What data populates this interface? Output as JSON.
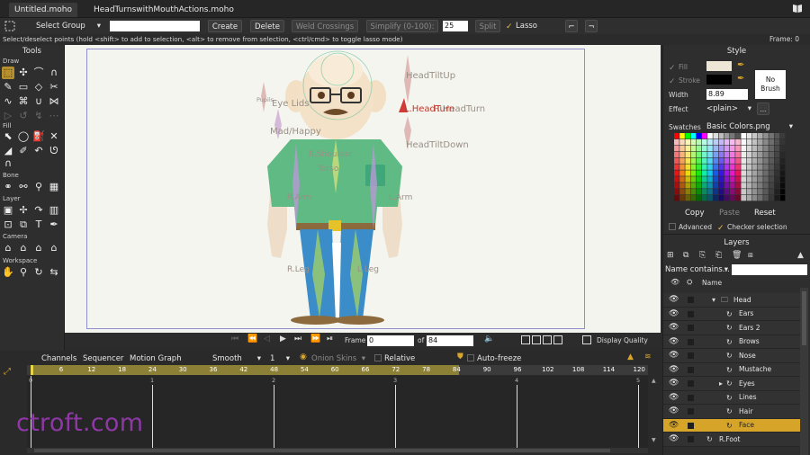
{
  "tabs": [
    {
      "label": "Untitled.moho"
    },
    {
      "label": "HeadTurnswithMouthActions.moho"
    }
  ],
  "toolbar": {
    "mode_select": "Select Group",
    "name_value": "",
    "create": "Create",
    "delete": "Delete",
    "weld": "Weld Crossings",
    "simplify": "Simplify (0-100):",
    "simplify_value": "25",
    "split": "Split",
    "lasso": "Lasso mode"
  },
  "hint": "Select/deselect points (hold <shift> to add to selection, <alt> to remove from selection, <ctrl/cmd> to toggle lasso mode)",
  "frame_readout": "Frame: 0",
  "tools": {
    "title": "Tools",
    "sections": [
      "Draw",
      "Fill",
      "Bone",
      "Layer",
      "Camera",
      "Workspace"
    ]
  },
  "canvas_labels": {
    "head_tilt_up": "HeadTiltUp",
    "head_turn": "L.HeadTurn",
    "head_turn_r": "R.HeadTurn",
    "head_tilt_down": "HeadTiltDown",
    "eye_lids": "Eye Lids",
    "pupils": "Pupils",
    "mad_happy": "Mad/Happy",
    "shoulder": "R.Shoulder",
    "torso": "Torso",
    "l_arm": "L.Arm",
    "r_arm": "R.Arm",
    "l_leg": "L.Leg",
    "r_leg": "R.Leg"
  },
  "playback": {
    "frame_label": "Frame",
    "frame_value": "0",
    "of_label": "of",
    "total_frames": "84",
    "display_quality": "Display Quality"
  },
  "timeline": {
    "tabs": [
      "Channels",
      "Sequencer",
      "Motion Graph"
    ],
    "interp": "Smooth",
    "interp_value": "1",
    "onion": "Onion Skins",
    "relative": "Relative keyframing",
    "autofreeze": "Auto-freeze keys",
    "ruler": [
      "6",
      "12",
      "18",
      "24",
      "30",
      "36",
      "42",
      "48",
      "54",
      "60",
      "66",
      "72",
      "78",
      "84",
      "90",
      "96",
      "102",
      "108",
      "114",
      "120"
    ],
    "seconds": [
      "0",
      "1",
      "2",
      "3",
      "4",
      "5"
    ]
  },
  "style": {
    "title": "Style",
    "fill": "Fill",
    "stroke": "Stroke",
    "no_brush": "No Brush",
    "width_label": "Width",
    "width_value": "8.89",
    "effect_label": "Effect",
    "effect_value": "<plain>",
    "effect_more": "...",
    "swatches_label": "Swatches",
    "swatches_value": "Basic Colors.png",
    "copy": "Copy",
    "paste": "Paste",
    "reset": "Reset",
    "advanced": "Advanced",
    "checker": "Checker selection"
  },
  "layers": {
    "title": "Layers",
    "name_filter": "Name contains...",
    "column_name": "Name",
    "rows": [
      {
        "name": "Head",
        "type": "group",
        "indent": 1
      },
      {
        "name": "Ears",
        "type": "switch",
        "indent": 2
      },
      {
        "name": "Ears 2",
        "type": "switch",
        "indent": 2
      },
      {
        "name": "Brows",
        "type": "switch",
        "indent": 2
      },
      {
        "name": "Nose",
        "type": "switch",
        "indent": 2
      },
      {
        "name": "Mustache",
        "type": "switch",
        "indent": 2
      },
      {
        "name": "Eyes",
        "type": "switch-expand",
        "indent": 2
      },
      {
        "name": "Lines",
        "type": "switch",
        "indent": 2
      },
      {
        "name": "Hair",
        "type": "switch",
        "indent": 2
      },
      {
        "name": "Face",
        "type": "switch",
        "indent": 2,
        "selected": true
      },
      {
        "name": "R.Foot",
        "type": "switch",
        "indent": 1
      }
    ]
  },
  "watermark": "ctroft.com",
  "colors": {
    "accent": "#d7a42a",
    "canvas": "#f4f4ee",
    "frame": "#8f8fcf"
  }
}
